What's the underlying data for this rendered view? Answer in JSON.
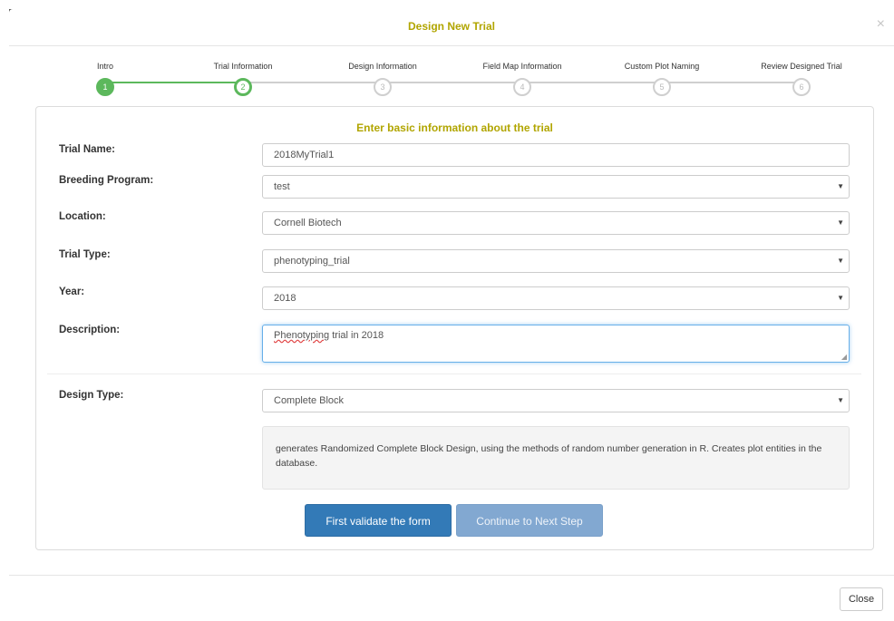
{
  "background": {
    "top_text": ""
  },
  "modal": {
    "title": "Design New Trial",
    "close_glyph": "×"
  },
  "wizard": {
    "steps": [
      {
        "label": "Intro",
        "number": "1",
        "state": "done"
      },
      {
        "label": "Trial Information",
        "number": "2",
        "state": "active"
      },
      {
        "label": "Design Information",
        "number": "3",
        "state": "pending"
      },
      {
        "label": "Field Map Information",
        "number": "4",
        "state": "pending"
      },
      {
        "label": "Custom Plot Naming",
        "number": "5",
        "state": "pending"
      },
      {
        "label": "Review Designed Trial",
        "number": "6",
        "state": "pending"
      }
    ]
  },
  "form": {
    "heading": "Enter basic information about the trial",
    "trial_name": {
      "label": "Trial Name:",
      "value": "2018MyTrial1"
    },
    "breeding_program": {
      "label": "Breeding Program:",
      "value": "test"
    },
    "location": {
      "label": "Location:",
      "value": "Cornell Biotech"
    },
    "trial_type": {
      "label": "Trial Type:",
      "value": "phenotyping_trial"
    },
    "year": {
      "label": "Year:",
      "value": "2018"
    },
    "description": {
      "label": "Description:",
      "value_misspelled": "Phenotyping",
      "value_rest": " trial in 2018"
    },
    "design_type": {
      "label": "Design Type:",
      "value": "Complete Block"
    },
    "design_help": "generates Randomized Complete Block Design, using the methods of random number generation in R. Creates plot entities in the database."
  },
  "buttons": {
    "validate": "First validate the form",
    "next": "Continue to Next Step",
    "close": "Close"
  },
  "colors": {
    "accent_title": "#b1a500",
    "step_done": "#5cb85c",
    "primary": "#337ab7"
  }
}
